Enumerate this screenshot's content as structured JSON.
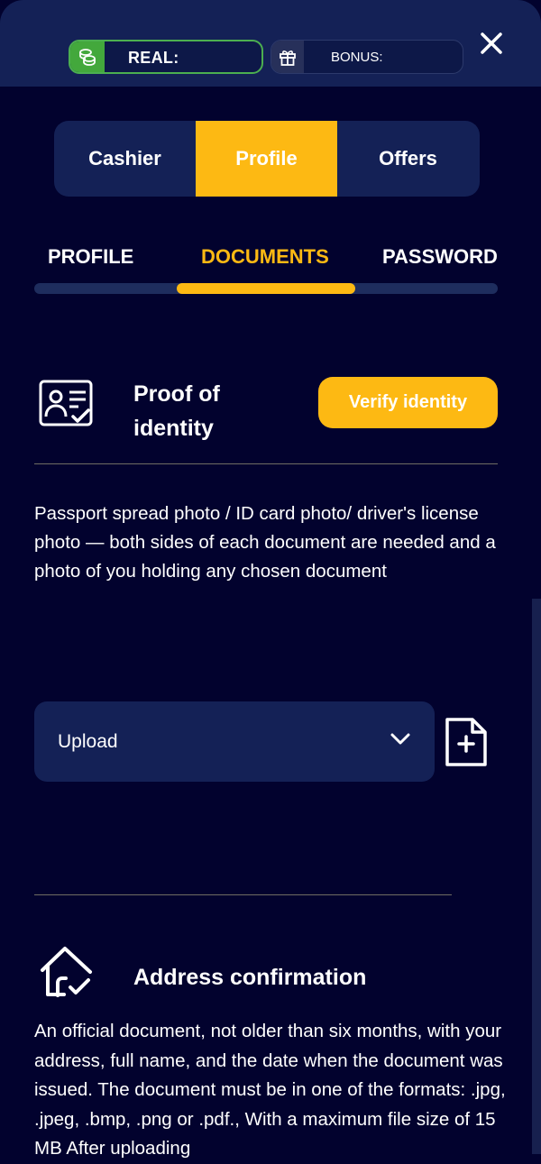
{
  "header": {
    "real_label": "REAL:",
    "bonus_label": "BONUS:",
    "icons": {
      "real": "coins-icon",
      "bonus": "gift-icon",
      "close": "close-icon"
    }
  },
  "main_tabs": [
    {
      "label": "Cashier",
      "active": false
    },
    {
      "label": "Profile",
      "active": true
    },
    {
      "label": "Offers",
      "active": false
    }
  ],
  "sub_tabs": [
    {
      "label": "PROFILE",
      "active": false
    },
    {
      "label": "DOCUMENTS",
      "active": true
    },
    {
      "label": "PASSWORD",
      "active": false
    }
  ],
  "identity": {
    "title": "Proof of identity",
    "verify_label": "Verify identity",
    "description": "Passport spread photo / ID card photo/ driver's license photo — both sides of each document are needed and a photo of you holding any chosen document",
    "upload_label": "Upload",
    "icons": {
      "section": "id-card-icon",
      "dropdown": "chevron-down-icon",
      "add": "add-file-icon"
    }
  },
  "address": {
    "title": "Address confirmation",
    "description": "An official document, not older than six months, with your address, full name, and the date when the document was issued. The document must be in one of the formats: .jpg, .jpeg, .bmp, .png or .pdf., With a maximum file size of 15 MB After uploading",
    "icon": "house-check-icon"
  },
  "colors": {
    "background": "#02022e",
    "panel": "#142156",
    "accent": "#fdb913",
    "real_green": "#43a83c"
  }
}
